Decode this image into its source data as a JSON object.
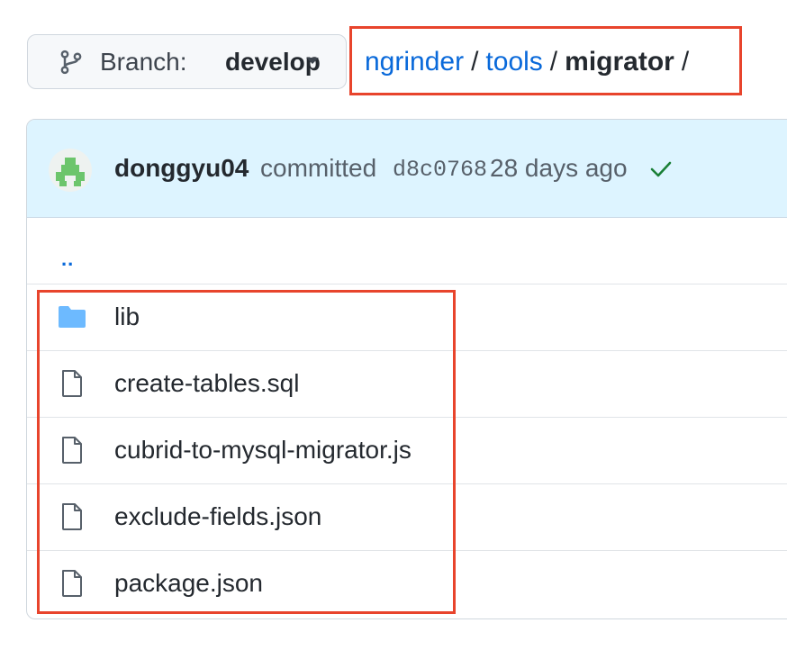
{
  "branch": {
    "prefix": "Branch:",
    "name": "develop",
    "icon": "git-branch-icon"
  },
  "breadcrumb": {
    "parts": [
      {
        "label": "ngrinder",
        "link": true
      },
      {
        "label": "tools",
        "link": true
      },
      {
        "label": "migrator",
        "link": false
      }
    ],
    "separator": "/"
  },
  "commit": {
    "author": "donggyu04",
    "verb": "committed",
    "sha": "d8c0768",
    "time": "28 days ago",
    "status_icon": "check-icon"
  },
  "files": {
    "parent": "..",
    "items": [
      {
        "name": "lib",
        "type": "folder"
      },
      {
        "name": "create-tables.sql",
        "type": "file"
      },
      {
        "name": "cubrid-to-mysql-migrator.js",
        "type": "file"
      },
      {
        "name": "exclude-fields.json",
        "type": "file"
      },
      {
        "name": "package.json",
        "type": "file"
      }
    ]
  },
  "colors": {
    "link": "#0969da",
    "highlight": "#e8442c",
    "commit_bar": "#ddf4ff",
    "success": "#1a7f37",
    "folder": "#54aeff"
  }
}
